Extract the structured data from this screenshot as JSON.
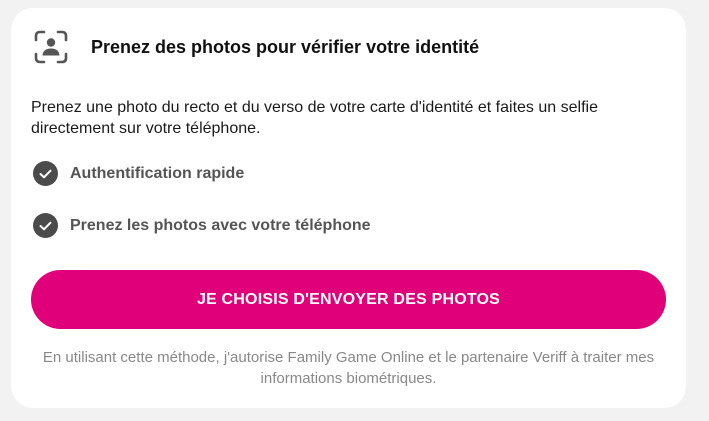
{
  "header": {
    "icon": "id-face-scan-icon",
    "title": "Prenez des photos pour vérifier votre identité"
  },
  "description": "Prenez une photo du recto et du verso de votre carte d'identité et faites un selfie directement sur votre téléphone.",
  "features": [
    {
      "icon": "check-circle-icon",
      "label": "Authentification rapide"
    },
    {
      "icon": "check-circle-icon",
      "label": "Prenez les photos avec votre téléphone"
    }
  ],
  "cta": {
    "label": "JE CHOISIS D'ENVOYER DES PHOTOS"
  },
  "consent": "En utilisant cette méthode, j'autorise Family Game Online et le partenaire Veriff à traiter mes informations biométriques.",
  "colors": {
    "background": "#f2f2f2",
    "card": "#ffffff",
    "accent": "#e0007a",
    "check": "#4b4b4b",
    "muted_text": "#888888"
  }
}
